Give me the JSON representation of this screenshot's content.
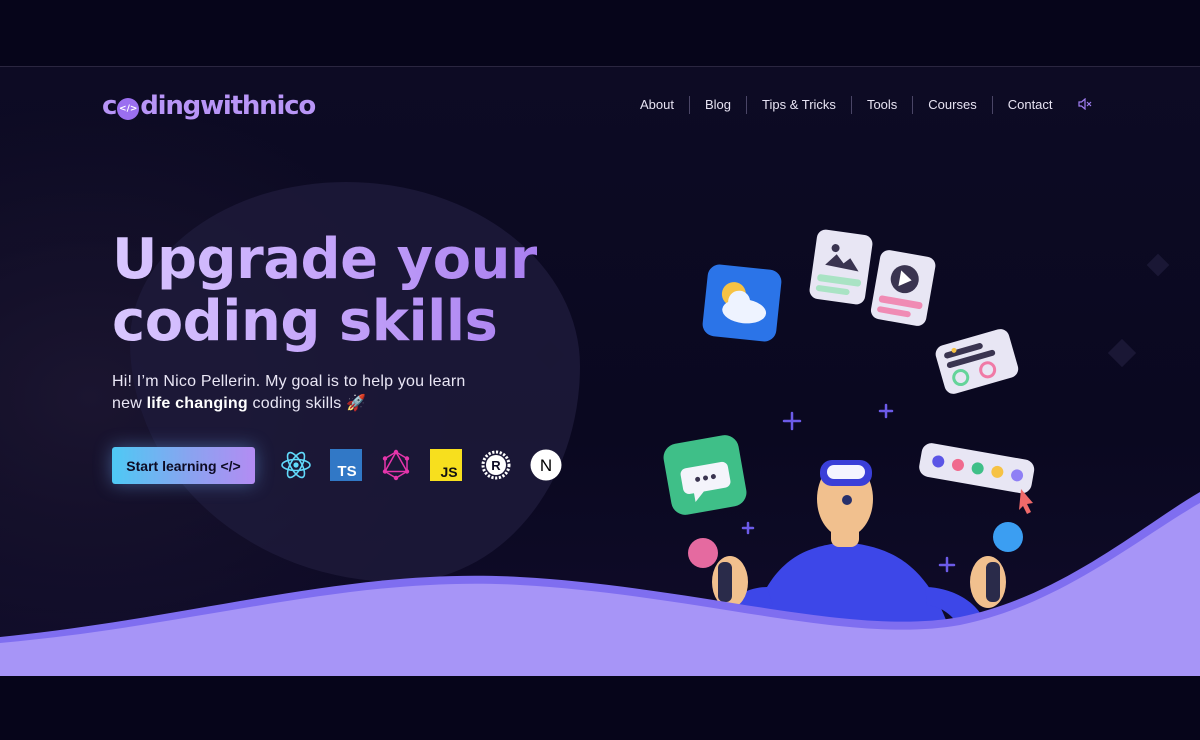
{
  "brand": {
    "logo_text_a": "c",
    "logo_badge": "</>",
    "logo_text_b": "dingwithnico"
  },
  "nav": {
    "items": [
      "About",
      "Blog",
      "Tips & Tricks",
      "Tools",
      "Courses",
      "Contact"
    ],
    "sound_icon": "mute-icon"
  },
  "hero": {
    "title_line1": "Upgrade your",
    "title_line2": "coding skills",
    "intro_a": "Hi! I’m Nico Pellerin. My goal is to help you learn new ",
    "intro_bold": "life changing",
    "intro_b": " coding skills 🚀",
    "cta_label": "Start learning",
    "cta_icon": "</>",
    "tech_icons": [
      "react-icon",
      "typescript-icon",
      "graphql-icon",
      "javascript-icon",
      "rust-icon",
      "nextjs-icon"
    ],
    "ts_text": "TS",
    "js_text": "JS",
    "next_text": "N"
  },
  "colors": {
    "accent": "#a78bfa",
    "background": "#0d0b24",
    "wave": "#a795f7",
    "cta_start": "#4ec9f4",
    "cta_end": "#b38cf3"
  }
}
